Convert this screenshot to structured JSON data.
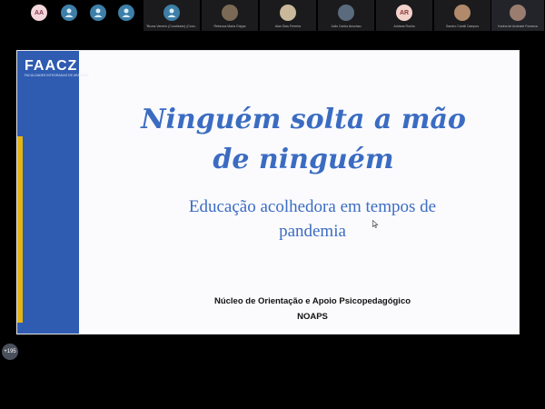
{
  "slide": {
    "logo": "FAACZ",
    "logo_subtitle": "FACULDADES INTEGRADAS DE ARACRUZ",
    "title_line1": "Ninguém solta a mão",
    "title_line2": "de ninguém",
    "subtitle_line1": "Educação acolhedora em tempos de",
    "subtitle_line2": "pandemia",
    "footer_line1": "Núcleo de Orientação e Apoio Psicopedagógico",
    "footer_line2": "NOAPS",
    "accent_blue": "#2f5bb1",
    "accent_gold": "#e3b511"
  },
  "participants": {
    "more_count": "+195",
    "initials_1": "AA",
    "initials_2": "AR",
    "names": [
      "\"Bruna Venerio (Convidado) (Conv...",
      "Rebecca Maria Grippa",
      "Alan Dias Ferreira",
      "João Carlos Anschau",
      "Adriana Rocha",
      "Sandro Camill Campos",
      "Karina de Andrade Fonseca"
    ]
  }
}
